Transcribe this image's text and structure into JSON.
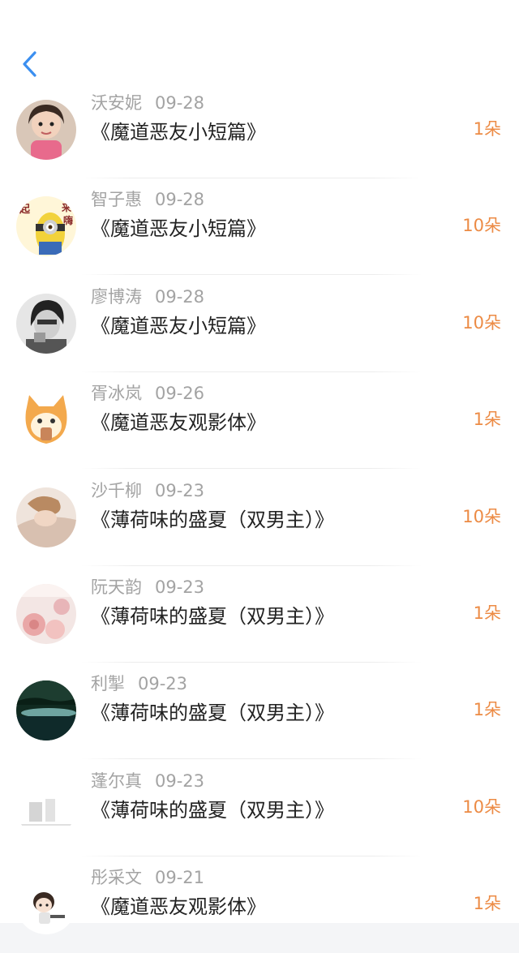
{
  "header": {
    "back_icon": "chevron-left-icon",
    "accent": "#3b8ff0"
  },
  "colors": {
    "amount": "#ec8b45",
    "name": "#a3a3a3",
    "title": "#222222"
  },
  "items": [
    {
      "name": "沃安妮",
      "date": "09-28",
      "title": "《魔道恶友小短篇》",
      "amount": "1朵",
      "avatar": "girl-photo-avatar"
    },
    {
      "name": "智子惠",
      "date": "09-28",
      "title": "《魔道恶友小短篇》",
      "amount": "10朵",
      "avatar": "minion-avatar",
      "avatar_text": "起来嗨"
    },
    {
      "name": "廖博涛",
      "date": "09-28",
      "title": "《魔道恶友小短篇》",
      "amount": "10朵",
      "avatar": "bw-portrait-avatar"
    },
    {
      "name": "胥冰岚",
      "date": "09-26",
      "title": "《魔道恶友观影体》",
      "amount": "1朵",
      "avatar": "cartoon-cat-avatar"
    },
    {
      "name": "沙千柳",
      "date": "09-23",
      "title": "《薄荷味的盛夏（双男主）》",
      "amount": "10朵",
      "avatar": "woman-photo-avatar"
    },
    {
      "name": "阮天韵",
      "date": "09-23",
      "title": "《薄荷味的盛夏（双男主）》",
      "amount": "1朵",
      "avatar": "flowers-avatar"
    },
    {
      "name": "利掣",
      "date": "09-23",
      "title": "《薄荷味的盛夏（双男主）》",
      "amount": "1朵",
      "avatar": "dark-landscape-avatar"
    },
    {
      "name": "蓬尔真",
      "date": "09-23",
      "title": "《薄荷味的盛夏（双男主）》",
      "amount": "10朵",
      "avatar": "faded-sketch-avatar"
    },
    {
      "name": "彤采文",
      "date": "09-21",
      "title": "《魔道恶友观影体》",
      "amount": "1朵",
      "avatar": "chibi-girl-avatar"
    }
  ]
}
